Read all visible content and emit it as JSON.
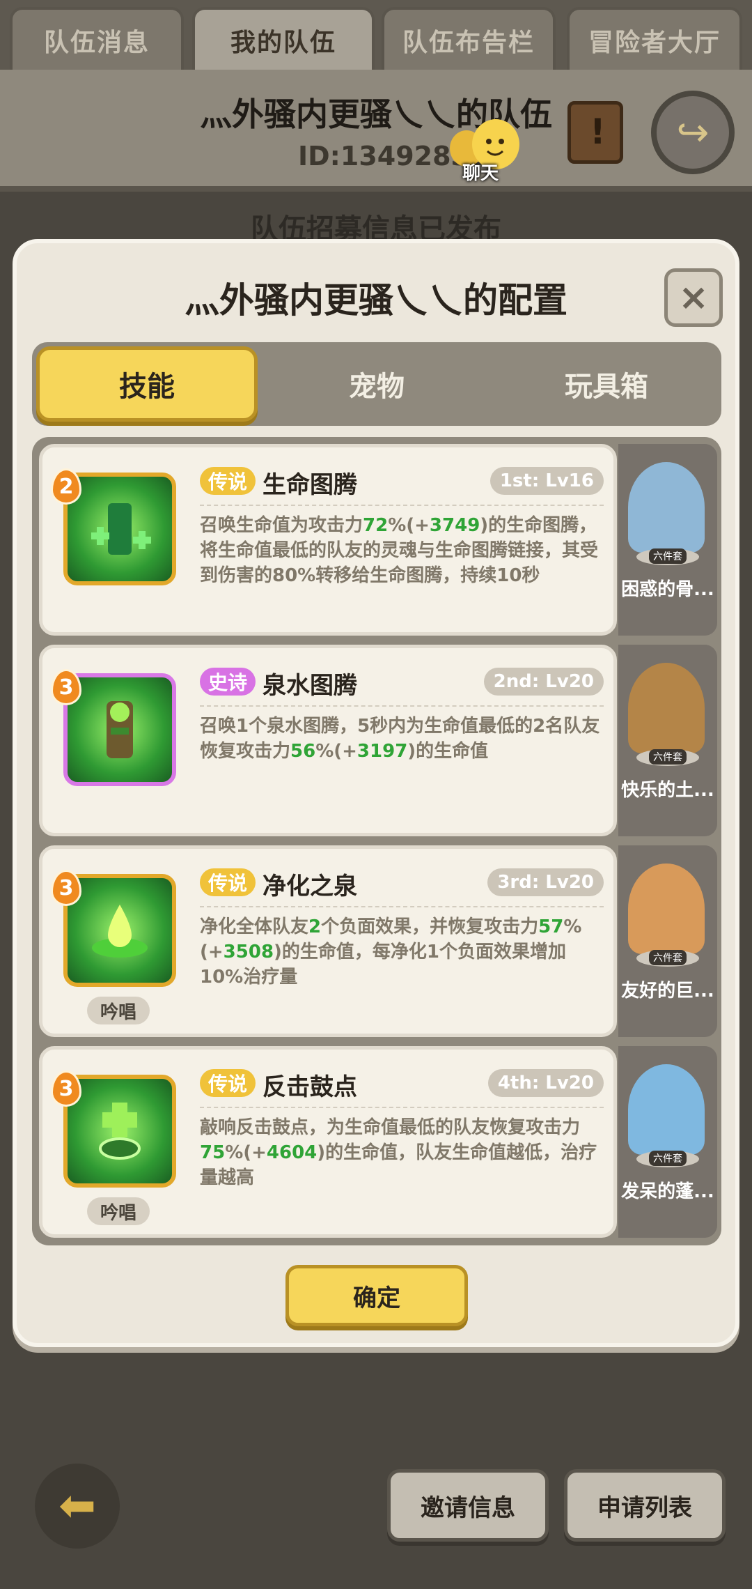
{
  "top_tabs": [
    "队伍消息",
    "我的队伍",
    "队伍布告栏",
    "冒险者大厅"
  ],
  "team": {
    "name": "灬外骚内更骚乀乀的队伍",
    "id": "ID:13492839",
    "chat_label": "聊天",
    "notice": "队伍招募信息已发布"
  },
  "modal": {
    "title": "灬外骚内更骚乀乀的配置",
    "close_icon": "×",
    "tabs": [
      "技能",
      "宠物",
      "玩具箱"
    ],
    "confirm": "确定"
  },
  "skills": [
    {
      "level": "2",
      "rarity": "传说",
      "name": "生命图腾",
      "rank": "1st: Lv16",
      "desc_parts": [
        "召唤生命值为攻击力",
        "72",
        "%(+",
        "3749",
        ")的生命图腾，将生命值最低的队友的灵魂与生命图腾链接，其受到伤害的80%转移给生命图腾，持续10秒"
      ],
      "chant": ""
    },
    {
      "level": "3",
      "rarity": "史诗",
      "name": "泉水图腾",
      "rank": "2nd: Lv20",
      "desc_parts": [
        "召唤1个泉水图腾，5秒内为生命值最低的2名队友恢复攻击力",
        "56",
        "%(+",
        "3197",
        ")的生命值"
      ],
      "chant": ""
    },
    {
      "level": "3",
      "rarity": "传说",
      "name": "净化之泉",
      "rank": "3rd: Lv20",
      "desc_parts": [
        "净化全体队友",
        "2",
        "个负面效果，并恢复攻击力",
        "57",
        "%(+",
        "3508",
        ")的生命值，每净化1个负面效果增加10%治疗量"
      ],
      "chant": "吟唱"
    },
    {
      "level": "3",
      "rarity": "传说",
      "name": "反击鼓点",
      "rank": "4th: Lv20",
      "desc_parts": [
        "敲响反击鼓点，为生命值最低的队友恢复攻击力",
        "75",
        "%(+",
        "4604",
        ")的生命值，队友生命值越低，治疗量越高"
      ],
      "chant": "吟唱"
    }
  ],
  "pets": [
    {
      "name": "困惑的骨...",
      "set": "六件套"
    },
    {
      "name": "快乐的土...",
      "set": "六件套"
    },
    {
      "name": "友好的巨...",
      "set": "六件套"
    },
    {
      "name": "发呆的蓬...",
      "set": "六件套"
    }
  ],
  "bottom": {
    "invite": "邀请信息",
    "apply": "申请列表"
  },
  "colors": {
    "accent_yellow": "#f6d65a",
    "legend": "#f0c23a",
    "epic": "#d872e4",
    "highlight_green": "#2fa436"
  }
}
